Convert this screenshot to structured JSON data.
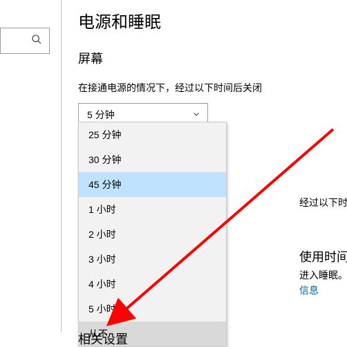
{
  "page_title": "电源和睡眠",
  "section_title": "屏幕",
  "screen_off": {
    "label": "在接通电源的情况下，经过以下时间后关闭",
    "selected": "5 分钟"
  },
  "dropdown_options": [
    "25 分钟",
    "30 分钟",
    "45 分钟",
    "1 小时",
    "2 小时",
    "3 小时",
    "4 小时",
    "5 小时",
    "从不"
  ],
  "dropdown_highlight_index": 2,
  "dropdown_hover_index": 8,
  "partial_behind_text": "经过以下时间后进入睡眠状态",
  "right_panel": {
    "title": "使用时间",
    "sub": "进入睡眠。",
    "link": "信息"
  },
  "bottom_section_title": "相关设置",
  "annotation": {
    "color": "#ff0000"
  }
}
